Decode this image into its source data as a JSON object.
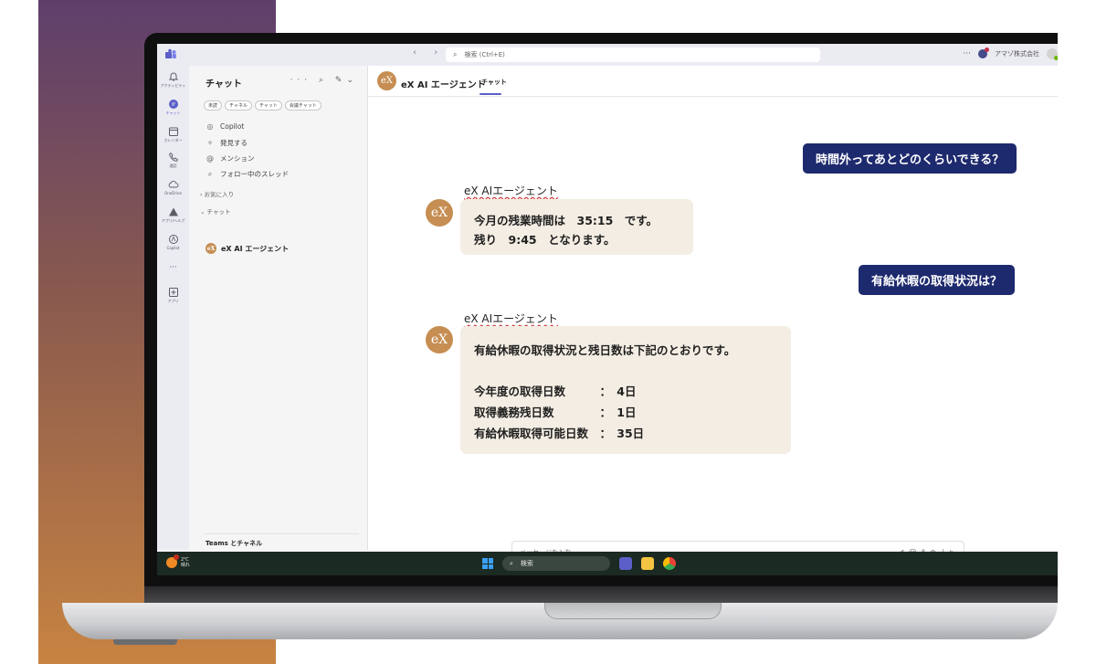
{
  "window": {
    "search_placeholder": "検索 (Ctrl+E)",
    "org_name": "アマゾ株式会社",
    "nav_arrows": "‹ ›",
    "more": "···"
  },
  "rail": {
    "items": [
      {
        "label": "アクティビティ",
        "icon": "bell-icon"
      },
      {
        "label": "チャット",
        "icon": "chat-icon"
      },
      {
        "label": "カレンダー",
        "icon": "calendar-icon"
      },
      {
        "label": "通話",
        "icon": "phone-icon"
      },
      {
        "label": "OneDrive",
        "icon": "cloud-icon"
      },
      {
        "label": "アプリ/ヘルプ",
        "icon": "triangle-icon"
      },
      {
        "label": "Copilot",
        "icon": "copilot-icon"
      },
      {
        "label": "···",
        "icon": "more-icon"
      },
      {
        "label": "アプリ",
        "icon": "apps-icon"
      }
    ]
  },
  "chat_list": {
    "title": "チャット",
    "actions": "··· ⌕ ✎⌄",
    "filters": [
      "未読",
      "チャネル",
      "チャット",
      "会議チャット"
    ],
    "quick_items": [
      {
        "icon": "copilot-icon",
        "label": "Copilot"
      },
      {
        "icon": "discover-icon",
        "label": "発見する"
      },
      {
        "icon": "mention-icon",
        "label": "メンション"
      },
      {
        "icon": "thread-icon",
        "label": "フォロー中のスレッド"
      }
    ],
    "favorites_label": "› お気に入り",
    "chats_label": "⌄ チャット",
    "agent_chat": "eX AI エージェント",
    "footer": "Teams とチャネル"
  },
  "conversation": {
    "header_name": "eX AI エージェント",
    "header_tab": "チャット",
    "logo_text": "eX",
    "messages": [
      {
        "role": "user",
        "text": "時間外ってあとどのくらいできる？"
      },
      {
        "role": "agent",
        "name": "eX AIエージェント",
        "lines": [
          "今月の残業時間は　35:15　です。",
          "残り　9:45　となります。"
        ]
      },
      {
        "role": "user",
        "text": "有給休暇の取得状況は？"
      },
      {
        "role": "agent",
        "name": "eX AIエージェント",
        "lines": [
          "有給休暇の取得状況と残日数は下記のとおりです。",
          "今年度の取得日数　　　：　4日",
          "取得義務残日数　　　　：　1日",
          "有給休暇取得可能日数　：　35日"
        ]
      }
    ],
    "compose_placeholder": "メッセージを入力",
    "compose_tools": "✍ ☺ ⚘ ⊕ ＋ ▷"
  },
  "taskbar": {
    "temperature": "2℃",
    "weather": "晴れ",
    "search_label": "検索"
  },
  "colors": {
    "accent": "#5b5fc7",
    "user_bubble": "#1e2a6e",
    "agent_bubble": "#f3ede3",
    "agent_logo": "#c68e52"
  }
}
